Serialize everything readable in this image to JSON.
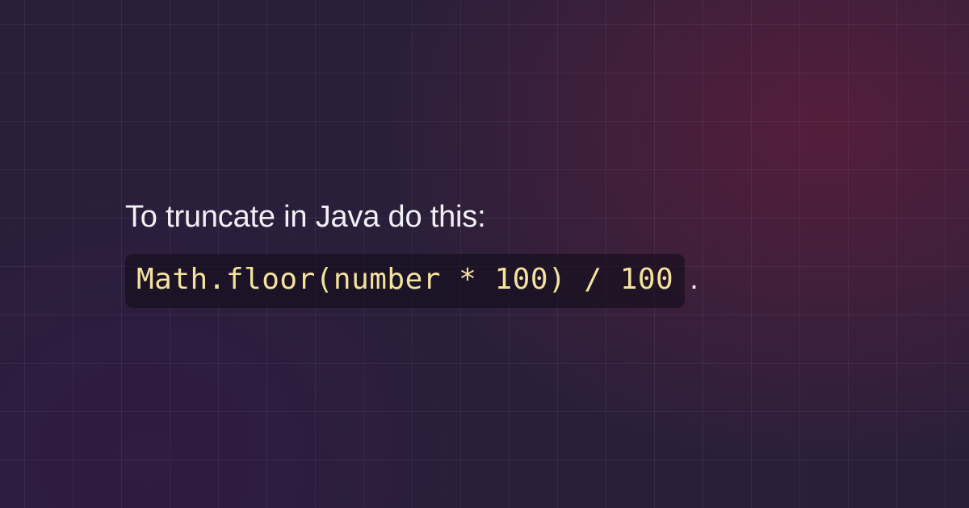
{
  "content": {
    "description": "To truncate in Java do this:",
    "code_snippet": "Math.floor(number * 100) / 100",
    "trailing_punctuation": "."
  },
  "colors": {
    "background_base": "#2a1f3a",
    "grid_line": "rgba(255,255,255,0.055)",
    "text": "#f2f0f5",
    "code_text": "#f3e39b",
    "code_bg": "rgba(20,14,28,0.65)"
  }
}
